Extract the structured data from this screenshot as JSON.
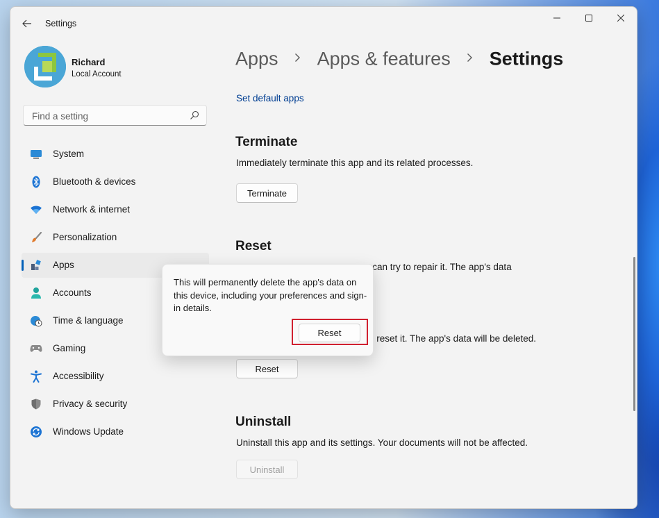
{
  "window": {
    "title": "Settings"
  },
  "profile": {
    "name": "Richard",
    "account_type": "Local Account"
  },
  "search": {
    "placeholder": "Find a setting"
  },
  "nav": {
    "items": [
      {
        "label": "System"
      },
      {
        "label": "Bluetooth & devices"
      },
      {
        "label": "Network & internet"
      },
      {
        "label": "Personalization"
      },
      {
        "label": "Apps"
      },
      {
        "label": "Accounts"
      },
      {
        "label": "Time & language"
      },
      {
        "label": "Gaming"
      },
      {
        "label": "Accessibility"
      },
      {
        "label": "Privacy & security"
      },
      {
        "label": "Windows Update"
      }
    ],
    "active": "Apps"
  },
  "breadcrumb": {
    "item1": "Apps",
    "item2": "Apps & features",
    "current": "Settings"
  },
  "content": {
    "default_apps_link": "Set default apps",
    "terminate": {
      "title": "Terminate",
      "description": "Immediately terminate this app and its related processes.",
      "button": "Terminate"
    },
    "reset": {
      "title": "Reset",
      "line1_visible": "e can try to repair it. The app's data",
      "line2_visible": "t, reset it. The app's data will be deleted.",
      "button": "Reset"
    },
    "uninstall": {
      "title": "Uninstall",
      "description": "Uninstall this app and its settings. Your documents will not be affected.",
      "button": "Uninstall"
    }
  },
  "flyout": {
    "message": "This will permanently delete the app's data on this device, including your preferences and sign-in details.",
    "button": "Reset"
  },
  "colors": {
    "accent": "#005fb8",
    "highlight_box": "#d0202f",
    "link": "#003e92"
  }
}
